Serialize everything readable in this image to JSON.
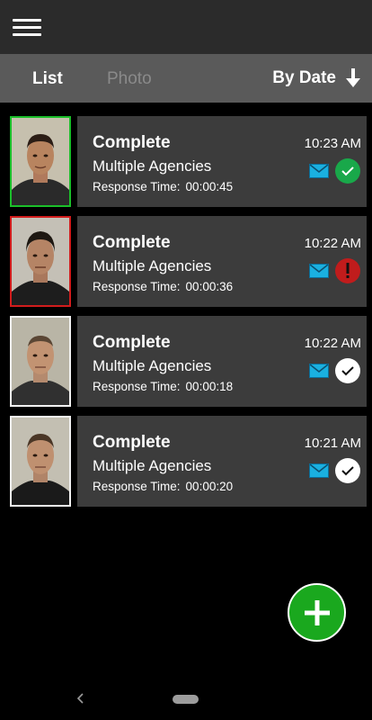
{
  "header": {
    "menu_icon": "hamburger-menu-icon"
  },
  "tabs": {
    "list_label": "List",
    "photo_label": "Photo",
    "sort_label": "By Date",
    "sort_icon": "arrow-down-icon"
  },
  "records": [
    {
      "status": "Complete",
      "agency": "Multiple Agencies",
      "response_label": "Response Time:",
      "response_time": "00:00:45",
      "time": "10:23 AM",
      "result": "success",
      "result_icon": "green-check-icon"
    },
    {
      "status": "Complete",
      "agency": "Multiple Agencies",
      "response_label": "Response Time:",
      "response_time": "00:00:36",
      "time": "10:22 AM",
      "result": "alert",
      "result_icon": "red-exclamation-icon"
    },
    {
      "status": "Complete",
      "agency": "Multiple Agencies",
      "response_label": "Response Time:",
      "response_time": "00:00:18",
      "time": "10:22 AM",
      "result": "done",
      "result_icon": "white-check-icon"
    },
    {
      "status": "Complete",
      "agency": "Multiple Agencies",
      "response_label": "Response Time:",
      "response_time": "00:00:20",
      "time": "10:21 AM",
      "result": "done",
      "result_icon": "white-check-icon"
    }
  ],
  "fab": {
    "icon": "plus-icon"
  },
  "colors": {
    "success": "#19a84a",
    "alert": "#c01c1c",
    "accent_green": "#1aa81e",
    "mail": "#1ab0e0"
  }
}
